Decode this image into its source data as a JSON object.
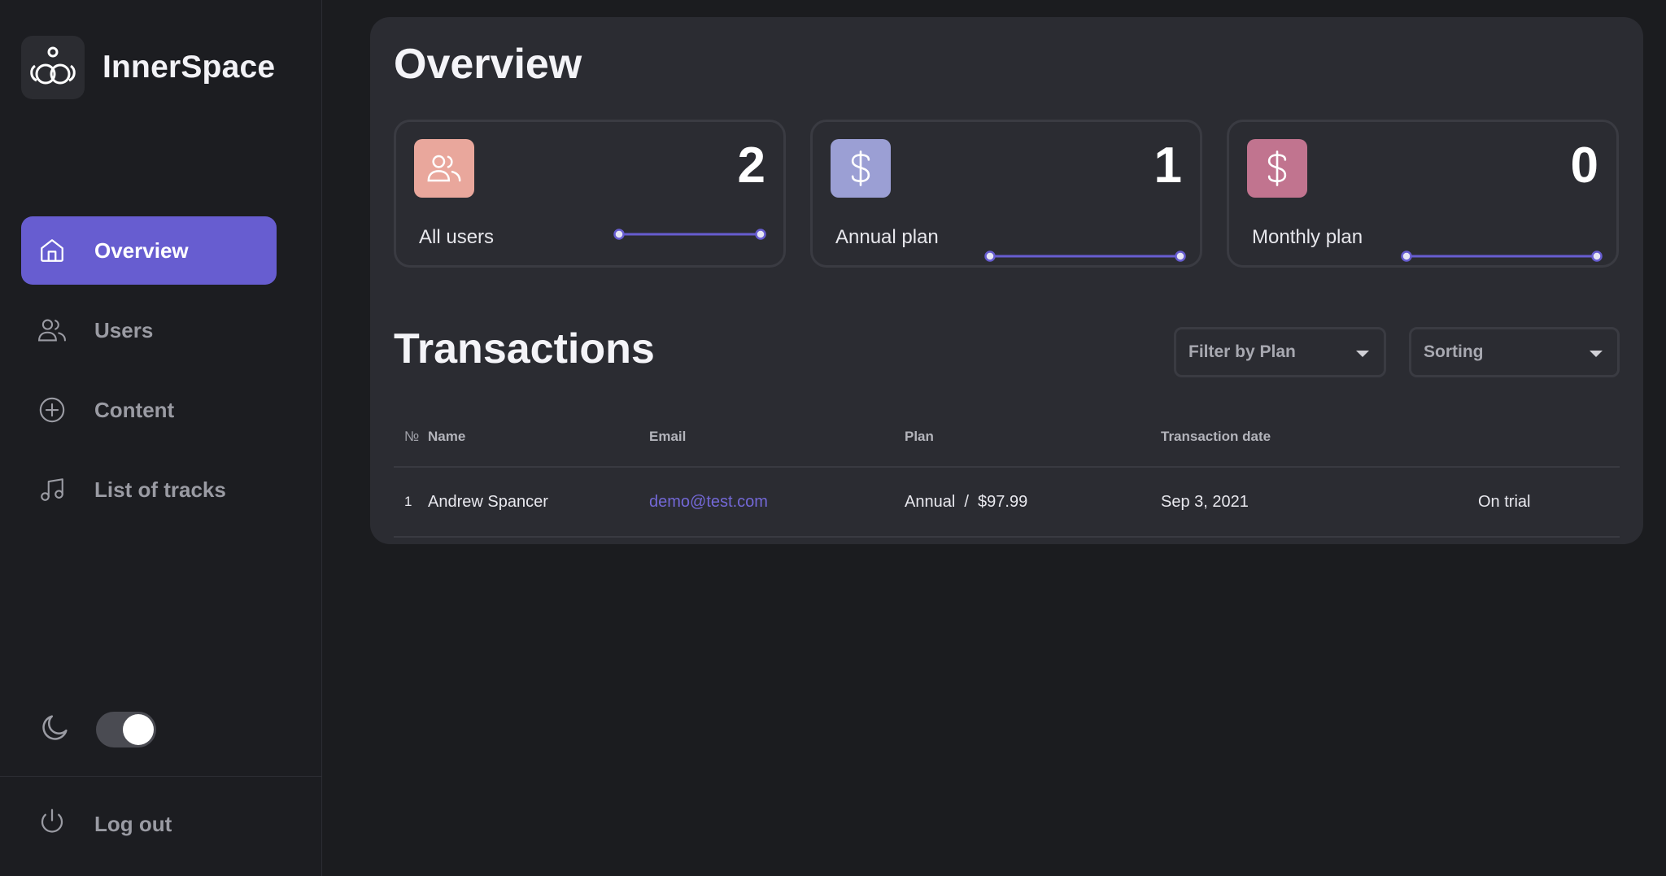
{
  "brand": {
    "name": "InnerSpace"
  },
  "sidebar": {
    "items": [
      {
        "label": "Overview",
        "icon": "home-icon",
        "active": true
      },
      {
        "label": "Users",
        "icon": "users-icon",
        "active": false
      },
      {
        "label": "Content",
        "icon": "plus-circle-icon",
        "active": false
      },
      {
        "label": "List of tracks",
        "icon": "music-note-icon",
        "active": false
      }
    ],
    "theme_toggle": {
      "icon": "moon-icon",
      "state": "on"
    },
    "logout_label": "Log out"
  },
  "overview": {
    "title": "Overview",
    "stats": [
      {
        "label": "All users",
        "value": "2",
        "icon": "users-icon",
        "color": "#e9a79c"
      },
      {
        "label": "Annual plan",
        "value": "1",
        "icon": "dollar-icon",
        "color": "#9b9fd4"
      },
      {
        "label": "Monthly plan",
        "value": "0",
        "icon": "dollar-icon",
        "color": "#c1748f"
      }
    ],
    "accent": "#675dd0"
  },
  "transactions": {
    "title": "Transactions",
    "filter_placeholder": "Filter by Plan",
    "sorting_placeholder": "Sorting",
    "columns": [
      "№",
      "Name",
      "Email",
      "Plan",
      "Transaction date",
      ""
    ],
    "rows": [
      {
        "num": "1",
        "name": "Andrew Spancer",
        "email": "demo@test.com",
        "plan": "Annual  /  $97.99",
        "date": "Sep 3, 2021",
        "status": "On trial"
      }
    ]
  }
}
